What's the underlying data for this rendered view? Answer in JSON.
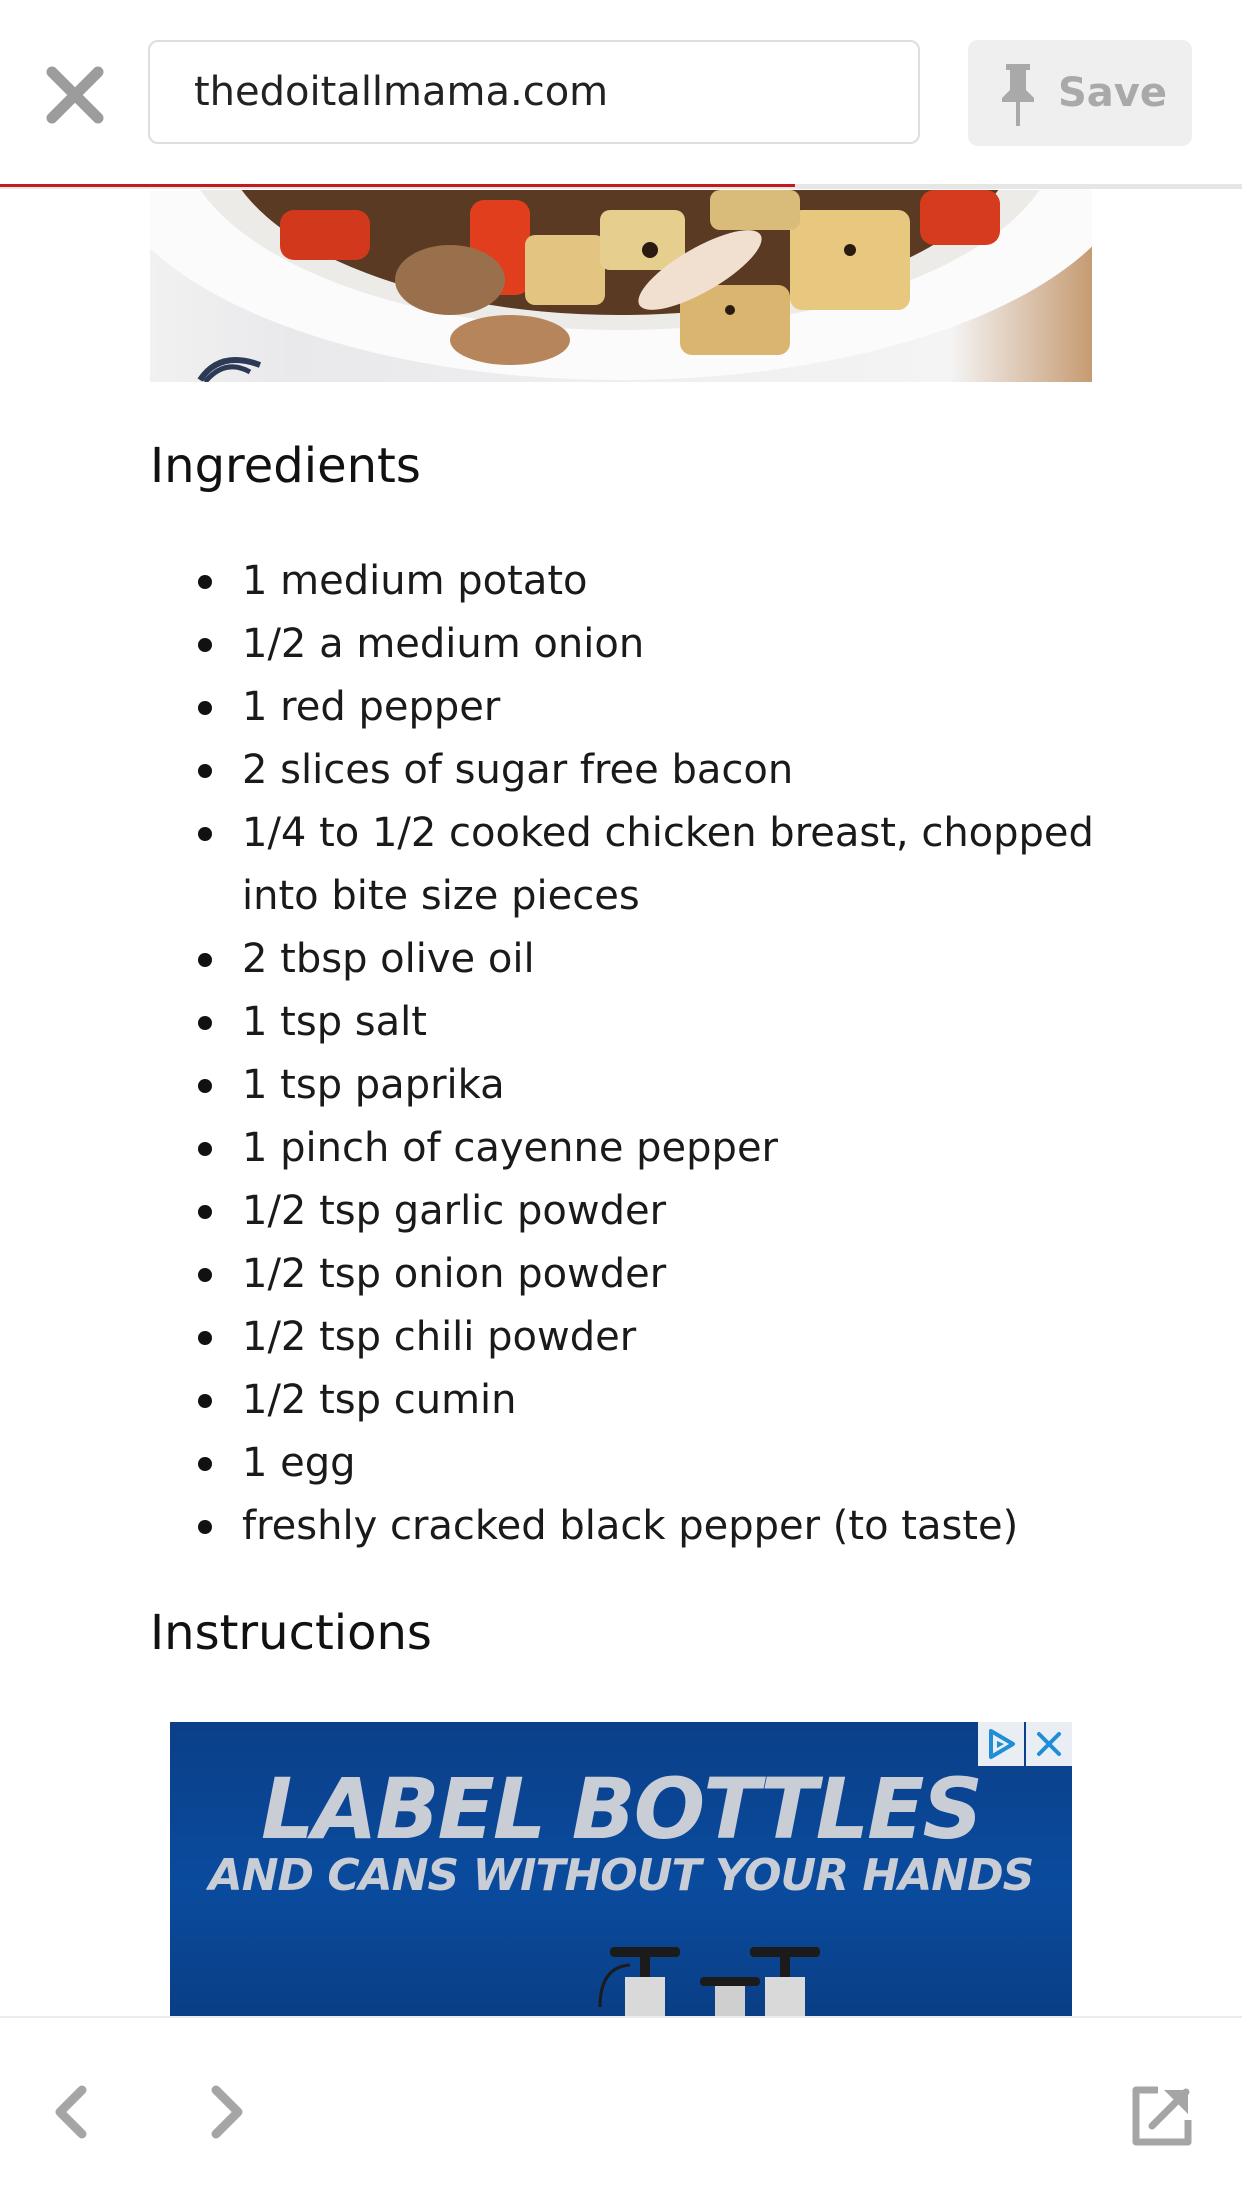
{
  "browser": {
    "url": "thedoitallmama.com",
    "save_label": "Save",
    "read_progress": 0.64
  },
  "article": {
    "ingredients_heading": "Ingredients",
    "ingredients": [
      "1 medium potato",
      "1/2 a medium onion",
      "1 red pepper",
      "2 slices of sugar free bacon",
      "1/4 to 1/2 cooked chicken breast, chopped into bite size pieces",
      "2 tbsp olive oil",
      "1 tsp salt",
      "1 tsp paprika",
      "1 pinch of cayenne pepper",
      "1/2 tsp garlic powder",
      "1/2 tsp onion powder",
      "1/2 tsp chili powder",
      "1/2 tsp cumin",
      "1 egg",
      "freshly cracked black pepper (to taste)"
    ],
    "instructions_heading": "Instructions"
  },
  "ad": {
    "headline": "LABEL BOTTLES",
    "subline": "AND CANS WITHOUT YOUR HANDS"
  },
  "colors": {
    "progress": "#c4191f",
    "ad_background": "#0a4b9e",
    "ad_text": "#c9ced6",
    "ad_icon": "#1e8fd6"
  },
  "icons": {
    "close": "close-icon",
    "pin": "pin-icon",
    "back": "chevron-left-icon",
    "forward": "chevron-right-icon",
    "external": "open-external-icon",
    "ad_choices": "ad-choices-icon",
    "ad_close": "close-icon"
  }
}
